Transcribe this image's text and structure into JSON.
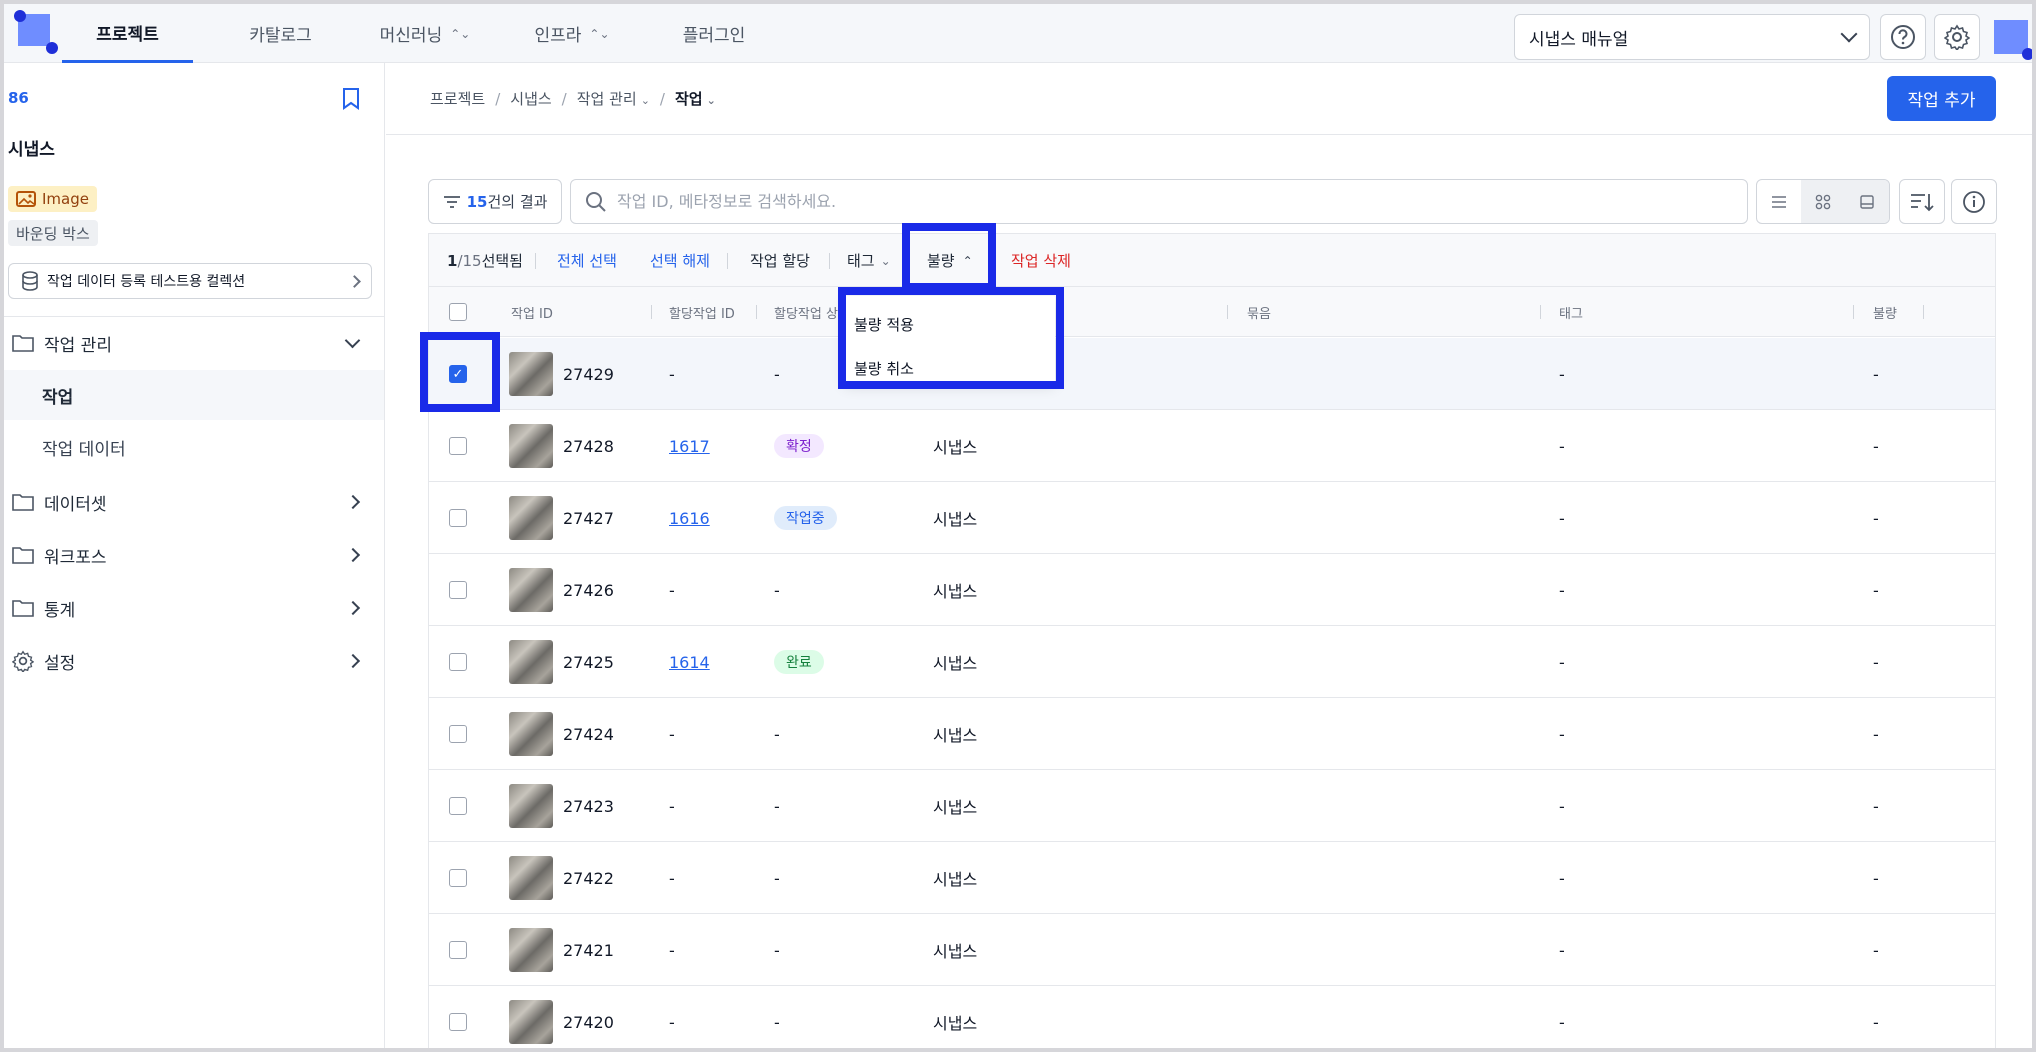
{
  "nav": {
    "tabs": [
      {
        "label": "프로젝트"
      },
      {
        "label": "카탈로그"
      },
      {
        "label": "머신러닝"
      },
      {
        "label": "인프라"
      },
      {
        "label": "플러그인"
      }
    ],
    "manual_select": "시냅스 매뉴얼"
  },
  "sidebar": {
    "project_id": "86",
    "project_name": "시냅스",
    "badge_type": "Image",
    "badge_annotation": "바운딩 박스",
    "collection": "작업 데이터 등록 테스트용 컬렉션",
    "menu": {
      "task_management": "작업 관리",
      "tasks": "작업",
      "task_data": "작업 데이터",
      "dataset": "데이터셋",
      "workspace": "워크포스",
      "stats": "통계",
      "settings": "설정"
    }
  },
  "breadcrumb": [
    "프로젝트",
    "시냅스",
    "작업 관리",
    "작업"
  ],
  "add_button": "작업 추가",
  "toolbar": {
    "results_count": "15",
    "results_suffix": "건의 결과",
    "search_placeholder": "작업 ID, 메타정보로 검색하세요.",
    "selected_count": "1",
    "selected_total": "/15",
    "selected_suffix": " 선택됨",
    "select_all": "전체 선택",
    "deselect": "선택 해제",
    "assign": "작업 할당",
    "tag": "태그",
    "defect": "불량",
    "delete": "작업 삭제"
  },
  "dropdown": {
    "apply": "불량 적용",
    "cancel": "불량 취소"
  },
  "columns": {
    "task_id": "작업 ID",
    "assign_id": "할당작업 ID",
    "assign_status": "할당작업 상",
    "group": "묶음",
    "tag": "태그",
    "defect": "불량"
  },
  "rows": [
    {
      "id": "27429",
      "assign_id": "-",
      "status": "-",
      "project": "",
      "tag": "-",
      "defect": "-",
      "checked": true
    },
    {
      "id": "27428",
      "assign_id": "1617",
      "status": "확정",
      "project": "시냅스",
      "tag": "-",
      "defect": "-"
    },
    {
      "id": "27427",
      "assign_id": "1616",
      "status": "작업중",
      "project": "시냅스",
      "tag": "-",
      "defect": "-"
    },
    {
      "id": "27426",
      "assign_id": "-",
      "status": "-",
      "project": "시냅스",
      "tag": "-",
      "defect": "-"
    },
    {
      "id": "27425",
      "assign_id": "1614",
      "status": "완료",
      "project": "시냅스",
      "tag": "-",
      "defect": "-"
    },
    {
      "id": "27424",
      "assign_id": "-",
      "status": "-",
      "project": "시냅스",
      "tag": "-",
      "defect": "-"
    },
    {
      "id": "27423",
      "assign_id": "-",
      "status": "-",
      "project": "시냅스",
      "tag": "-",
      "defect": "-"
    },
    {
      "id": "27422",
      "assign_id": "-",
      "status": "-",
      "project": "시냅스",
      "tag": "-",
      "defect": "-"
    },
    {
      "id": "27421",
      "assign_id": "-",
      "status": "-",
      "project": "시냅스",
      "tag": "-",
      "defect": "-"
    },
    {
      "id": "27420",
      "assign_id": "-",
      "status": "-",
      "project": "시냅스",
      "tag": "-",
      "defect": "-"
    }
  ],
  "colors": {
    "accent": "#2563eb",
    "highlight": "#1a2ae8",
    "pill_confirmed_bg": "#f3e8ff",
    "pill_confirmed_fg": "#7e22ce",
    "pill_working_bg": "#e0ecfb",
    "pill_working_fg": "#2563eb",
    "pill_done_bg": "#dcfce7",
    "pill_done_fg": "#15803d"
  }
}
